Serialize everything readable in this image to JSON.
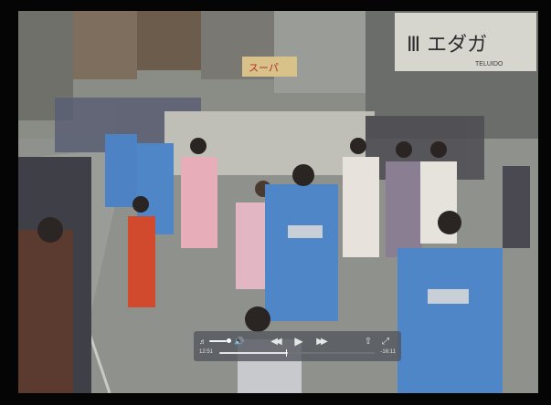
{
  "player": {
    "elapsed_time": "12:51",
    "remaining_time": "-16:11",
    "progress": 0.44,
    "volume": 0.8
  },
  "video_frame": {
    "signs": {
      "sign_right_top": "Ⅲ エダガ",
      "sign_right_bottom": "TELUIDO",
      "sign_center": "スーパ"
    }
  },
  "icons": {
    "volume_low": "speaker-low-icon",
    "volume_high": "speaker-high-icon",
    "rewind": "rewind-icon",
    "play": "play-icon",
    "fast_forward": "fast-forward-icon",
    "share": "share-icon",
    "fullscreen": "fullscreen-icon"
  },
  "colors": {
    "controls_bg": "#52545c",
    "controls_fg": "#e6e6e6"
  }
}
